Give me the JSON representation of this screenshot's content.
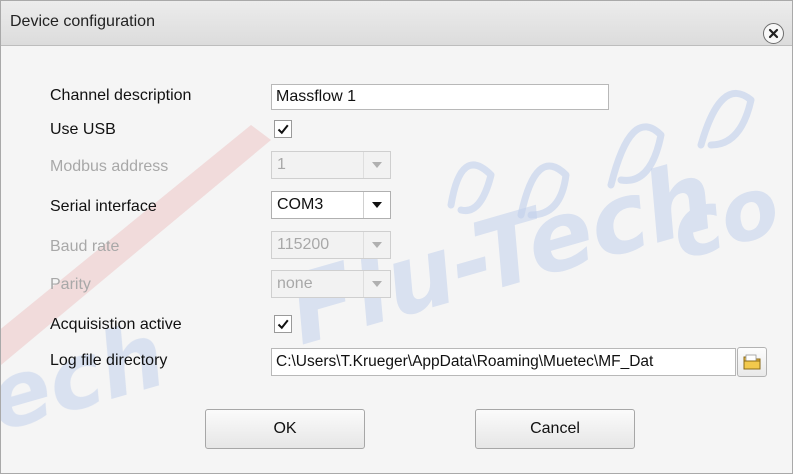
{
  "dialog": {
    "title": "Device configuration",
    "close_icon": "close-circle-icon"
  },
  "fields": {
    "channel_description": {
      "label": "Channel description",
      "value": "Massflow 1"
    },
    "use_usb": {
      "label": "Use USB",
      "checked": true
    },
    "modbus_address": {
      "label": "Modbus address",
      "value": "1",
      "disabled": true
    },
    "serial_interface": {
      "label": "Serial interface",
      "value": "COM3",
      "disabled": false
    },
    "baud_rate": {
      "label": "Baud rate",
      "value": "115200",
      "disabled": true
    },
    "parity": {
      "label": "Parity",
      "value": "none",
      "disabled": true
    },
    "acquisition_active": {
      "label": "Acquisistion active",
      "checked": true
    },
    "log_file_directory": {
      "label": "Log file directory",
      "value": "C:\\Users\\T.Krueger\\AppData\\Roaming\\Muetec\\MF_Dat",
      "browse_icon": "folder-icon"
    }
  },
  "buttons": {
    "ok": "OK",
    "cancel": "Cancel"
  },
  "colors": {
    "disabled_text": "#a8a8a8",
    "watermark": "#c1d0ec",
    "watermark_accent": "#ecc4c4"
  }
}
